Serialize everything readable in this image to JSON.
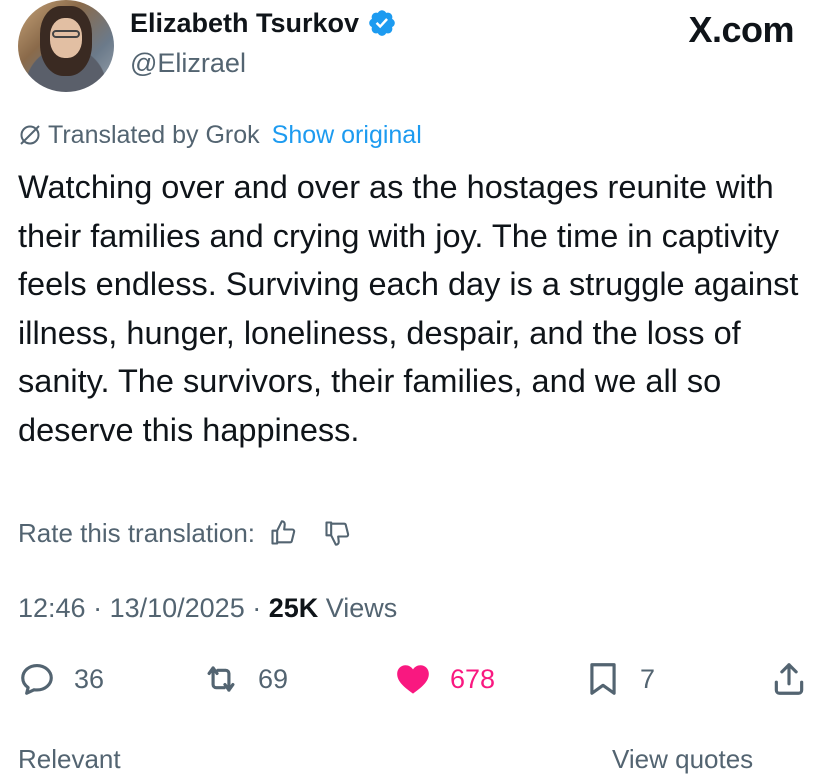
{
  "author": {
    "name": "Elizabeth Tsurkov",
    "handle": "@Elizrael",
    "verified": true
  },
  "brand": {
    "logo_text": "X.com"
  },
  "translation": {
    "label": "Translated by Grok",
    "show_original": "Show original"
  },
  "tweet": {
    "text": "Watching over and over as the hostages reunite with their families and crying with joy. The time in captivity feels endless. Surviving each day is a struggle against illness, hunger, loneliness, despair, and the loss of sanity. The survivors, their families, and we all so deserve this happiness."
  },
  "rate": {
    "label": "Rate this translation:"
  },
  "meta": {
    "time": "12:46",
    "date": "13/10/2025",
    "views_count": "25K",
    "views_label": "Views"
  },
  "actions": {
    "replies": "36",
    "reposts": "69",
    "likes": "678",
    "bookmarks": "7"
  },
  "footer": {
    "left": "Relevant",
    "right": "View quotes"
  },
  "colors": {
    "accent": "#1d9bf0",
    "like": "#f91880",
    "muted": "#536471",
    "text": "#0f1419"
  }
}
